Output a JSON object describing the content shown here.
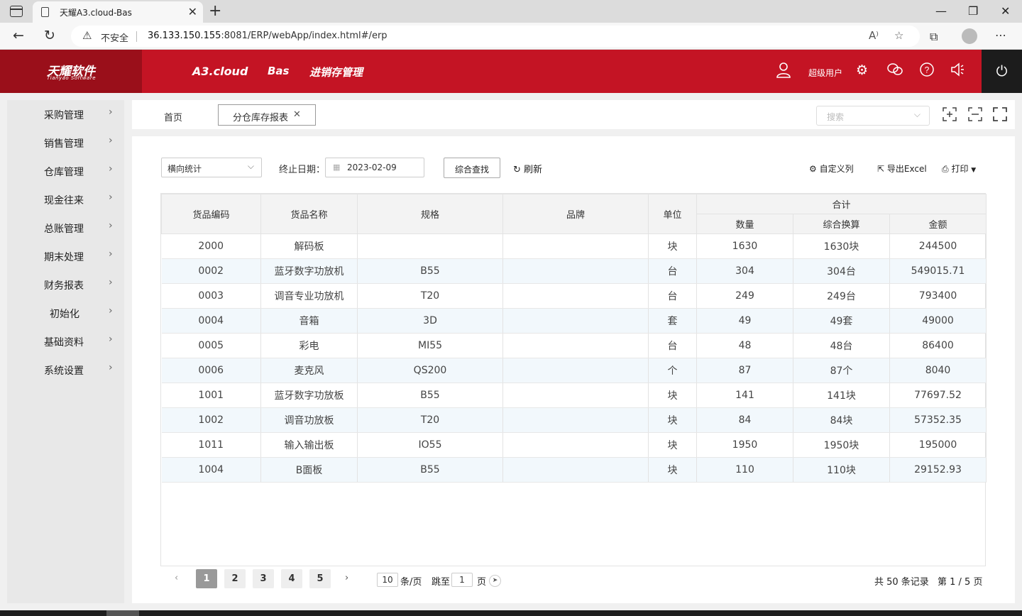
{
  "browser": {
    "tab_title": "天耀A3.cloud-Bas",
    "security_label": "不安全",
    "url_host": "36.133.150.155",
    "url_rest": ":8081/ERP/webApp/index.html#/erp"
  },
  "header": {
    "logo_main": "天耀软件",
    "logo_sub": "Tianyao Software",
    "nav": [
      "A3.cloud",
      "Bas",
      "进销存管理"
    ],
    "user_label": "超级用户",
    "colors": {
      "brand": "#c41424",
      "logo_bg": "#9a0f1a",
      "power_bg": "#1c1c1c"
    }
  },
  "sidebar": {
    "items": [
      "采购管理",
      "销售管理",
      "仓库管理",
      "现金往来",
      "总账管理",
      "期末处理",
      "财务报表",
      "初始化",
      "基础资料",
      "系统设置"
    ]
  },
  "tabs": {
    "home": "首页",
    "active": "分仓库存报表",
    "search_placeholder": "搜索"
  },
  "toolbar": {
    "mode_select": "横向统计",
    "date_label": "终止日期：",
    "date_value": "2023-02-09",
    "search_button": "综合查找",
    "refresh": "刷新",
    "custom_columns": "自定义列",
    "export_excel": "导出Excel",
    "print": "打印"
  },
  "table": {
    "headers": {
      "code": "货品编码",
      "name": "货品名称",
      "spec": "规格",
      "brand": "品牌",
      "unit": "单位",
      "total": "合计",
      "qty": "数量",
      "conv": "综合换算",
      "amount": "金额"
    },
    "rows": [
      {
        "code": "2000",
        "name": "解码板",
        "spec": "",
        "brand": "",
        "unit": "块",
        "qty": "1630",
        "conv": "1630块",
        "amount": "244500"
      },
      {
        "code": "0002",
        "name": "蓝牙数字功放机",
        "spec": "B55",
        "brand": "",
        "unit": "台",
        "qty": "304",
        "conv": "304台",
        "amount": "549015.71"
      },
      {
        "code": "0003",
        "name": "调音专业功放机",
        "spec": "T20",
        "brand": "",
        "unit": "台",
        "qty": "249",
        "conv": "249台",
        "amount": "793400"
      },
      {
        "code": "0004",
        "name": "音箱",
        "spec": "3D",
        "brand": "",
        "unit": "套",
        "qty": "49",
        "conv": "49套",
        "amount": "49000"
      },
      {
        "code": "0005",
        "name": "彩电",
        "spec": "MI55",
        "brand": "",
        "unit": "台",
        "qty": "48",
        "conv": "48台",
        "amount": "86400"
      },
      {
        "code": "0006",
        "name": "麦克风",
        "spec": "QS200",
        "brand": "",
        "unit": "个",
        "qty": "87",
        "conv": "87个",
        "amount": "8040"
      },
      {
        "code": "1001",
        "name": "蓝牙数字功放板",
        "spec": "B55",
        "brand": "",
        "unit": "块",
        "qty": "141",
        "conv": "141块",
        "amount": "77697.52"
      },
      {
        "code": "1002",
        "name": "调音功放板",
        "spec": "T20",
        "brand": "",
        "unit": "块",
        "qty": "84",
        "conv": "84块",
        "amount": "57352.35"
      },
      {
        "code": "1011",
        "name": "输入输出板",
        "spec": "IO55",
        "brand": "",
        "unit": "块",
        "qty": "1950",
        "conv": "1950块",
        "amount": "195000"
      },
      {
        "code": "1004",
        "name": "B面板",
        "spec": "B55",
        "brand": "",
        "unit": "块",
        "qty": "110",
        "conv": "110块",
        "amount": "29152.93"
      }
    ]
  },
  "pagination": {
    "pages": [
      "1",
      "2",
      "3",
      "4",
      "5"
    ],
    "current": "1",
    "page_size": "10",
    "page_size_suffix": "条/页",
    "jump_label": "跳至",
    "jump_value": "1",
    "jump_suffix": "页",
    "total_records": "共 50 条记录",
    "page_info": "第 1 / 5 页"
  }
}
